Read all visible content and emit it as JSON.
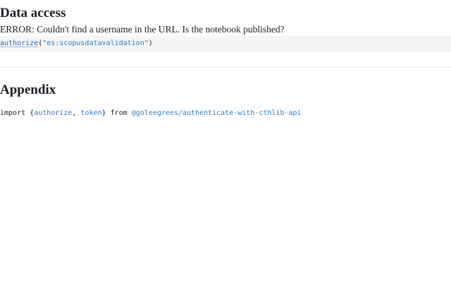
{
  "sections": {
    "data_access": {
      "title": "Data access",
      "error": "ERROR: Couldn't find a username in the URL. Is the notebook published?",
      "code": {
        "fn": "authorize",
        "open_paren": "(",
        "arg": "\"es:scopusdatavalidation\"",
        "close_paren": ")"
      }
    },
    "appendix": {
      "title": "Appendix",
      "import": {
        "kw_import": "import",
        "open_brace": "{",
        "name1": "authorize",
        "sep": ", ",
        "name2": "token",
        "close_brace": "}",
        "kw_from": "from",
        "module": "@goleegrees/authenticate-with-cthlib-api"
      }
    }
  },
  "colors": {
    "text": "#1b1e23",
    "link": "#1f6cb2",
    "string": "#2a7fbf",
    "code_bg": "#f5f5f5"
  }
}
